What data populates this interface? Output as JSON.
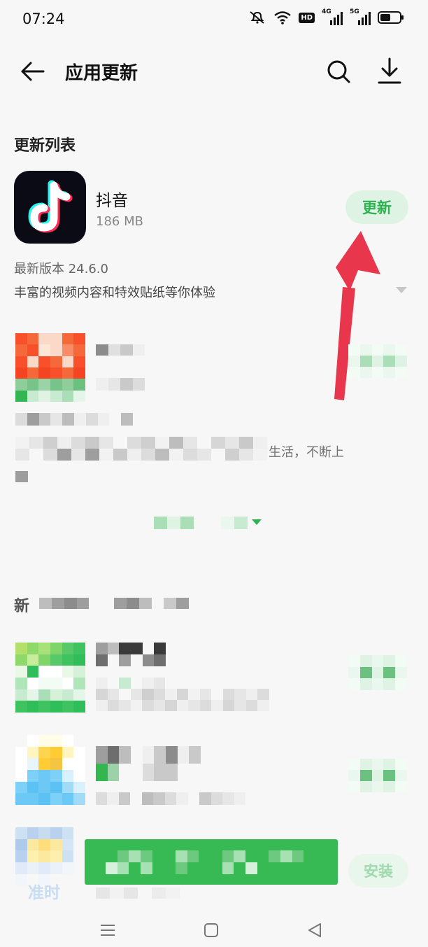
{
  "status_bar": {
    "time": "07:24",
    "hd_badge": "HD",
    "sim1_label": "4G",
    "sim2_label": "5G",
    "icons": [
      "mute-icon",
      "wifi-icon",
      "hd-icon",
      "signal-4g-icon",
      "signal-5g-icon",
      "battery-icon"
    ]
  },
  "header": {
    "title": "应用更新",
    "back_icon": "back-arrow-icon",
    "search_icon": "search-icon",
    "download_icon": "download-icon"
  },
  "section": {
    "title": "更新列表"
  },
  "first_app": {
    "name": "抖音",
    "size": "186 MB",
    "button_label": "更新",
    "version": "最新版本 24.6.0",
    "description": "丰富的视频内容和特效贴纸等你体验",
    "icon": "douyin-logo-icon"
  },
  "partial_visible": {
    "fragment": "生活，不断上",
    "section_char": "新"
  },
  "install_button": {
    "label": "安装"
  },
  "faded_label": "准时",
  "colors": {
    "accent_green": "#2eb24f",
    "button_bg": "#dff3e5",
    "annotation_red": "#e8364c",
    "toast_green": "#37b954",
    "background": "#f7f7f7"
  },
  "nav_bar": {
    "icons": [
      "menu-icon",
      "home-icon",
      "back-icon"
    ]
  }
}
